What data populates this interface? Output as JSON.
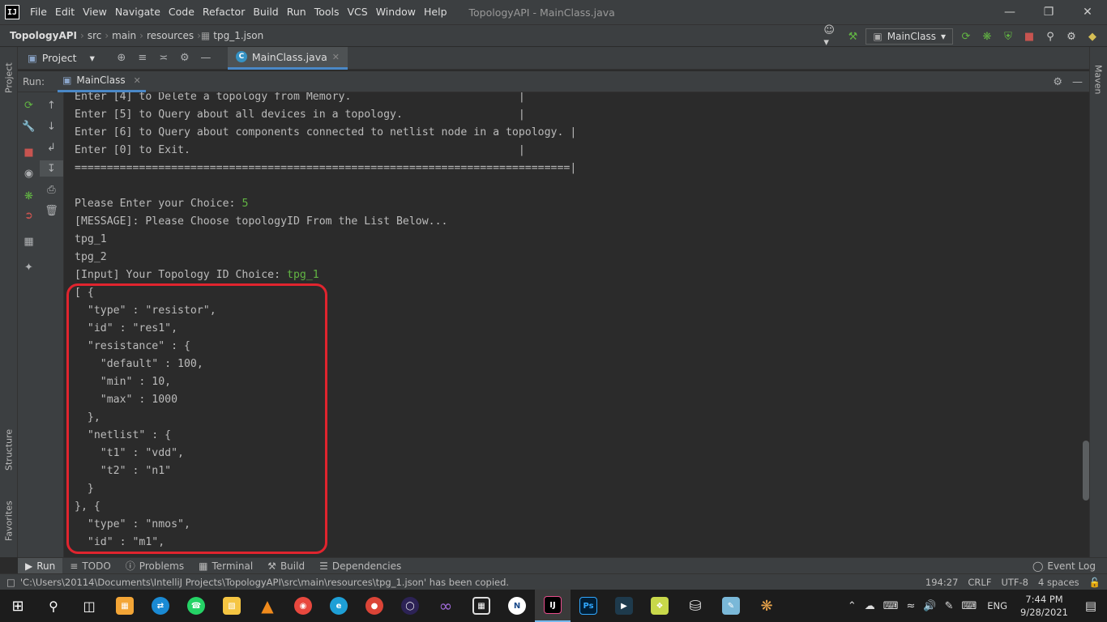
{
  "app": {
    "logo": "IJ",
    "window_title": "TopologyAPI - MainClass.java",
    "menu": [
      "File",
      "Edit",
      "View",
      "Navigate",
      "Code",
      "Refactor",
      "Build",
      "Run",
      "Tools",
      "VCS",
      "Window",
      "Help"
    ]
  },
  "breadcrumbs": [
    "TopologyAPI",
    "src",
    "main",
    "resources",
    "tpg_1.json"
  ],
  "run_config": "MainClass",
  "tool_window": {
    "project_label": "Project",
    "editor_tab": "MainClass.java"
  },
  "side_tabs": {
    "project": "Project",
    "structure": "Structure",
    "favorites": "Favorites",
    "maven": "Maven"
  },
  "run_window": {
    "label": "Run:",
    "tab": "MainClass"
  },
  "console": {
    "lines": [
      {
        "text": "Enter [4] to Delete a topology from Memory.                          |"
      },
      {
        "text": "Enter [5] to Query about all devices in a topology.                  |"
      },
      {
        "text": "Enter [6] to Query about components connected to netlist node in a topology. |"
      },
      {
        "text": "Enter [0] to Exit.                                                   |"
      },
      {
        "text": "=============================================================================|"
      },
      {
        "text": ""
      },
      {
        "text": "Please Enter your Choice: ",
        "input": "5"
      },
      {
        "text": "[MESSAGE]: Please Choose topologyID From the List Below..."
      },
      {
        "text": "tpg_1"
      },
      {
        "text": "tpg_2"
      },
      {
        "text": "[Input] Your Topology ID Choice: ",
        "input": "tpg_1"
      },
      {
        "text": "[ {"
      },
      {
        "text": "  \"type\" : \"resistor\","
      },
      {
        "text": "  \"id\" : \"res1\","
      },
      {
        "text": "  \"resistance\" : {"
      },
      {
        "text": "    \"default\" : 100,"
      },
      {
        "text": "    \"min\" : 10,"
      },
      {
        "text": "    \"max\" : 1000"
      },
      {
        "text": "  },"
      },
      {
        "text": "  \"netlist\" : {"
      },
      {
        "text": "    \"t1\" : \"vdd\","
      },
      {
        "text": "    \"t2\" : \"n1\""
      },
      {
        "text": "  }"
      },
      {
        "text": "}, {"
      },
      {
        "text": "  \"type\" : \"nmos\","
      },
      {
        "text": "  \"id\" : \"m1\","
      }
    ]
  },
  "bottom_tabs": [
    "Run",
    "TODO",
    "Problems",
    "Terminal",
    "Build",
    "Dependencies"
  ],
  "event_log": "Event Log",
  "status": {
    "message": "'C:\\Users\\20114\\Documents\\IntelliJ Projects\\TopologyAPI\\src\\main\\resources\\tpg_1.json' has been copied.",
    "position": "194:27",
    "line_ending": "CRLF",
    "encoding": "UTF-8",
    "indent": "4 spaces"
  },
  "taskbar": {
    "lang": "ENG",
    "time": "7:44 PM",
    "date": "9/28/2021"
  },
  "colors": {
    "accent": "#4a88c7",
    "highlight": "#e0242e",
    "user_input": "#62b543"
  }
}
